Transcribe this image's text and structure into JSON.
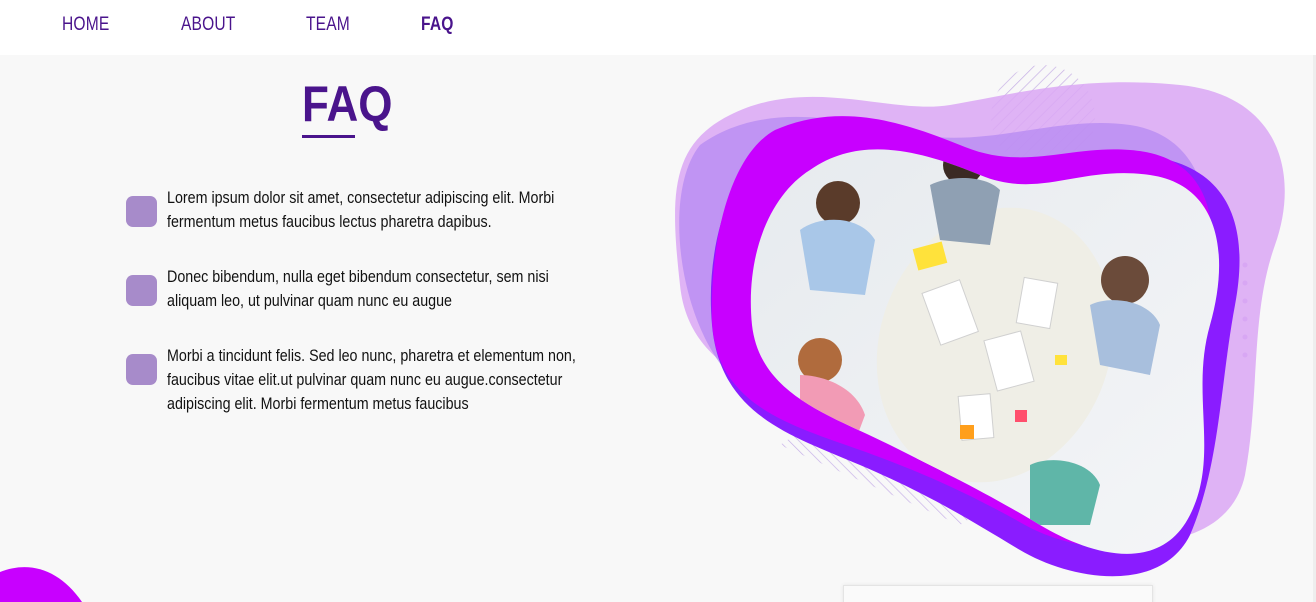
{
  "nav": {
    "items": [
      {
        "label": "HOME"
      },
      {
        "label": "ABOUT"
      },
      {
        "label": "TEAM"
      },
      {
        "label": "FAQ",
        "active": true
      }
    ]
  },
  "faq": {
    "title": "FAQ",
    "items": [
      {
        "text": "Lorem ipsum dolor sit amet, consectetur adipiscing elit. Morbi fermentum metus faucibus lectus pharetra dapibus."
      },
      {
        "text": "Donec bibendum, nulla eget bibendum consectetur, sem nisi aliquam leo, ut pulvinar quam nunc eu augue"
      },
      {
        "text": "Morbi a tincidunt felis. Sed leo nunc, pharetra et elementum non, faucibus vitae elit.ut pulvinar quam nunc eu augue.consectetur adipiscing elit. Morbi fermentum metus faucibus"
      }
    ]
  },
  "colors": {
    "brand": "#4a148c",
    "bullet": "#a78bca",
    "blob_light": "#d9a3f2",
    "blob_mid": "#b07cf0",
    "blob_magenta": "#c800ff",
    "blob_violet": "#8a1cff"
  },
  "hero": {
    "image": "team-meeting-photo"
  }
}
